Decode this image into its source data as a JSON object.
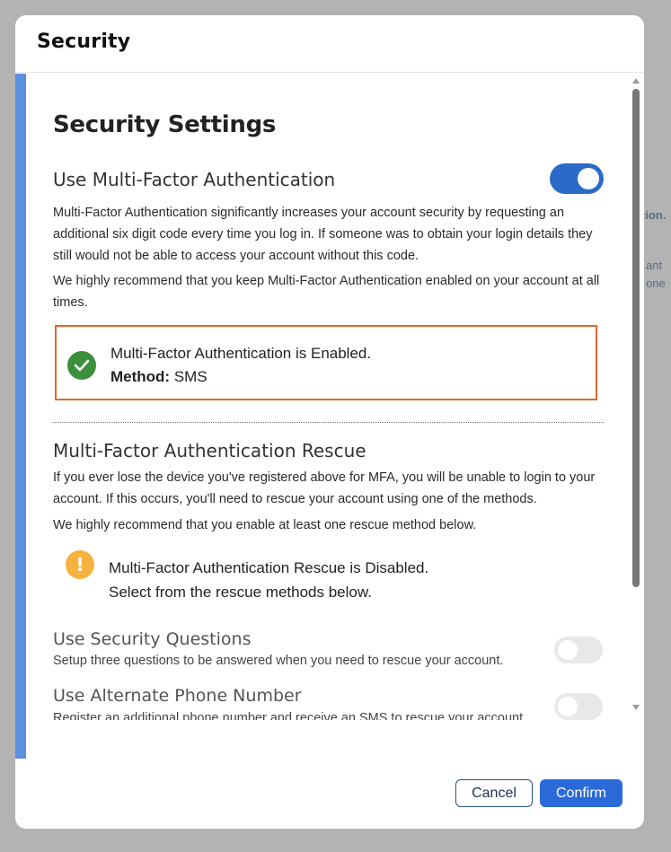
{
  "background": {
    "fragments": [
      "tion.",
      "ant",
      "one"
    ]
  },
  "modal": {
    "title": "Security",
    "cancel_label": "Cancel",
    "confirm_label": "Confirm"
  },
  "settings": {
    "heading": "Security Settings",
    "mfa": {
      "label": "Use Multi-Factor Authentication",
      "enabled": true,
      "description1": "Multi-Factor Authentication significantly increases your account security by requesting an additional six digit code every time you log in. If someone was to obtain your login details they still would not be able to access your account without this code.",
      "description2": "We highly recommend that you keep Multi-Factor Authentication enabled on your account at all times.",
      "status_text": "Multi-Factor Authentication is Enabled.",
      "method_label": "Method:",
      "method_value": "SMS"
    },
    "rescue": {
      "heading": "Multi-Factor Authentication Rescue",
      "description1": "If you ever lose the device you've registered above for MFA, you will be unable to login to your account. If this occurs, you'll need to rescue your account using one of the methods.",
      "description2": "We highly recommend that you enable at least one rescue method below.",
      "status_line1": "Multi-Factor Authentication Rescue is Disabled.",
      "status_line2": "Select from the rescue methods below.",
      "options": [
        {
          "title": "Use Security Questions",
          "description": "Setup three questions to be answered when you need to rescue your account.",
          "enabled": false
        },
        {
          "title": "Use Alternate Phone Number",
          "description": "Register an additional phone number and receive an SMS to rescue your account.",
          "enabled": false
        }
      ]
    }
  },
  "colors": {
    "accent_bar": "#5b8fe0",
    "toggle_on": "#2a6bc9",
    "success": "#3c8f3c",
    "warning": "#f6b23e",
    "highlight_border": "#e2672a",
    "confirm_button": "#2a6bd9"
  },
  "icons": {
    "success": "check-circle-icon",
    "warning": "exclamation-circle-icon"
  }
}
